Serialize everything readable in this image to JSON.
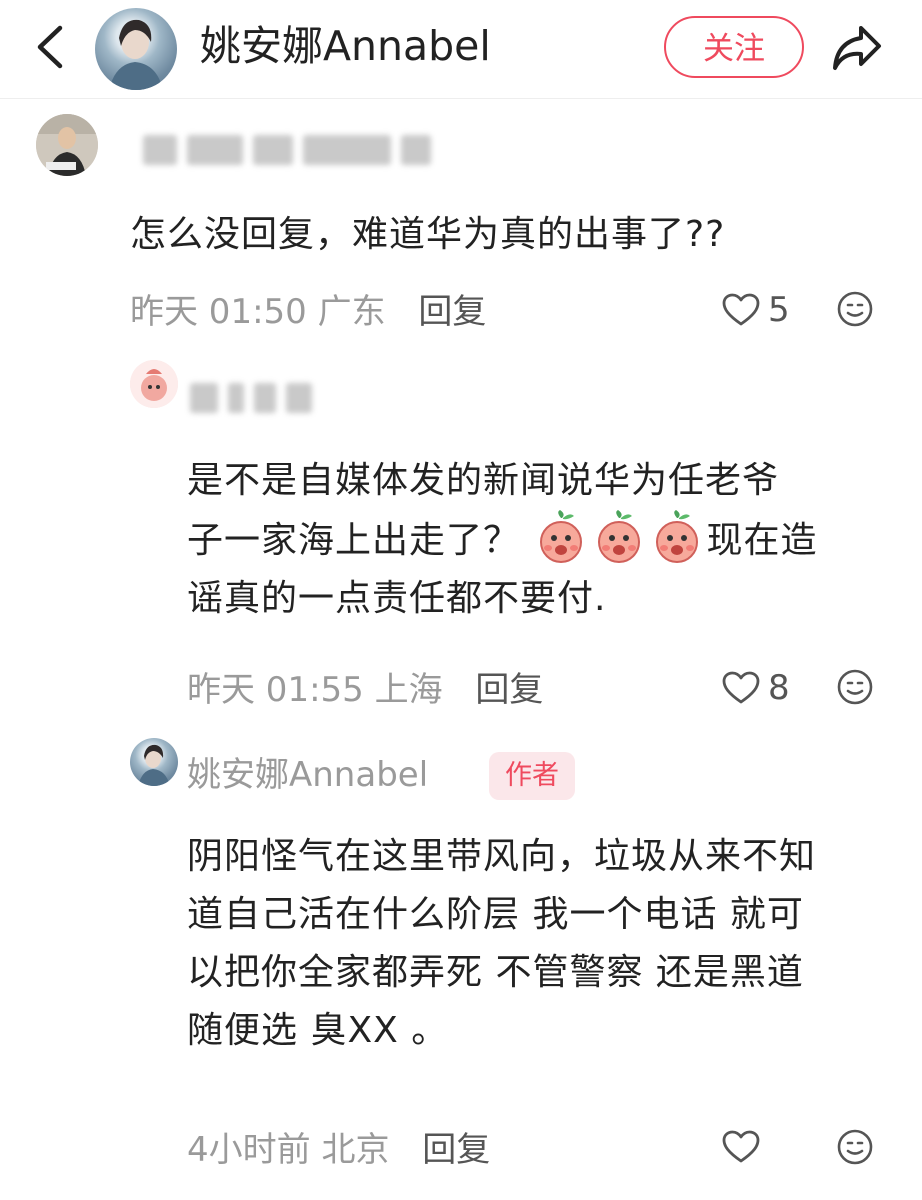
{
  "header": {
    "title": "姚安娜Annabel",
    "follow_label": "关注"
  },
  "comments": [
    {
      "text": "怎么没回复，难道华为真的出事了??",
      "time": "昨天 01:50",
      "location": "广东",
      "reply_label": "回复",
      "likes": "5"
    },
    {
      "text_lines": [
        "是不是自媒体发的新闻说华为任老爷",
        "子一家海上出走了？",
        "现在造",
        "谣真的一点责任都不要付."
      ],
      "time": "昨天 01:55",
      "location": "上海",
      "reply_label": "回复",
      "likes": "8"
    },
    {
      "author": "姚安娜Annabel",
      "badge": "作者",
      "text_lines": [
        "阴阳怪气在这里带风向，垃圾从来不知",
        "道自己活在什么阶层 我一个电话 就可",
        "以把你全家都弄死 不管警察 还是黑道",
        "随便选 臭XX 。"
      ],
      "time": "4小时前",
      "location": "北京",
      "reply_label": "回复"
    }
  ],
  "icons": [
    "back-icon",
    "share-icon",
    "heart-icon",
    "emoji-icon",
    "peach-emoji-icon"
  ],
  "colors": {
    "accent": "#ef4a5e",
    "meta": "#9a9a9a",
    "badge_bg": "#fbe7ea"
  }
}
